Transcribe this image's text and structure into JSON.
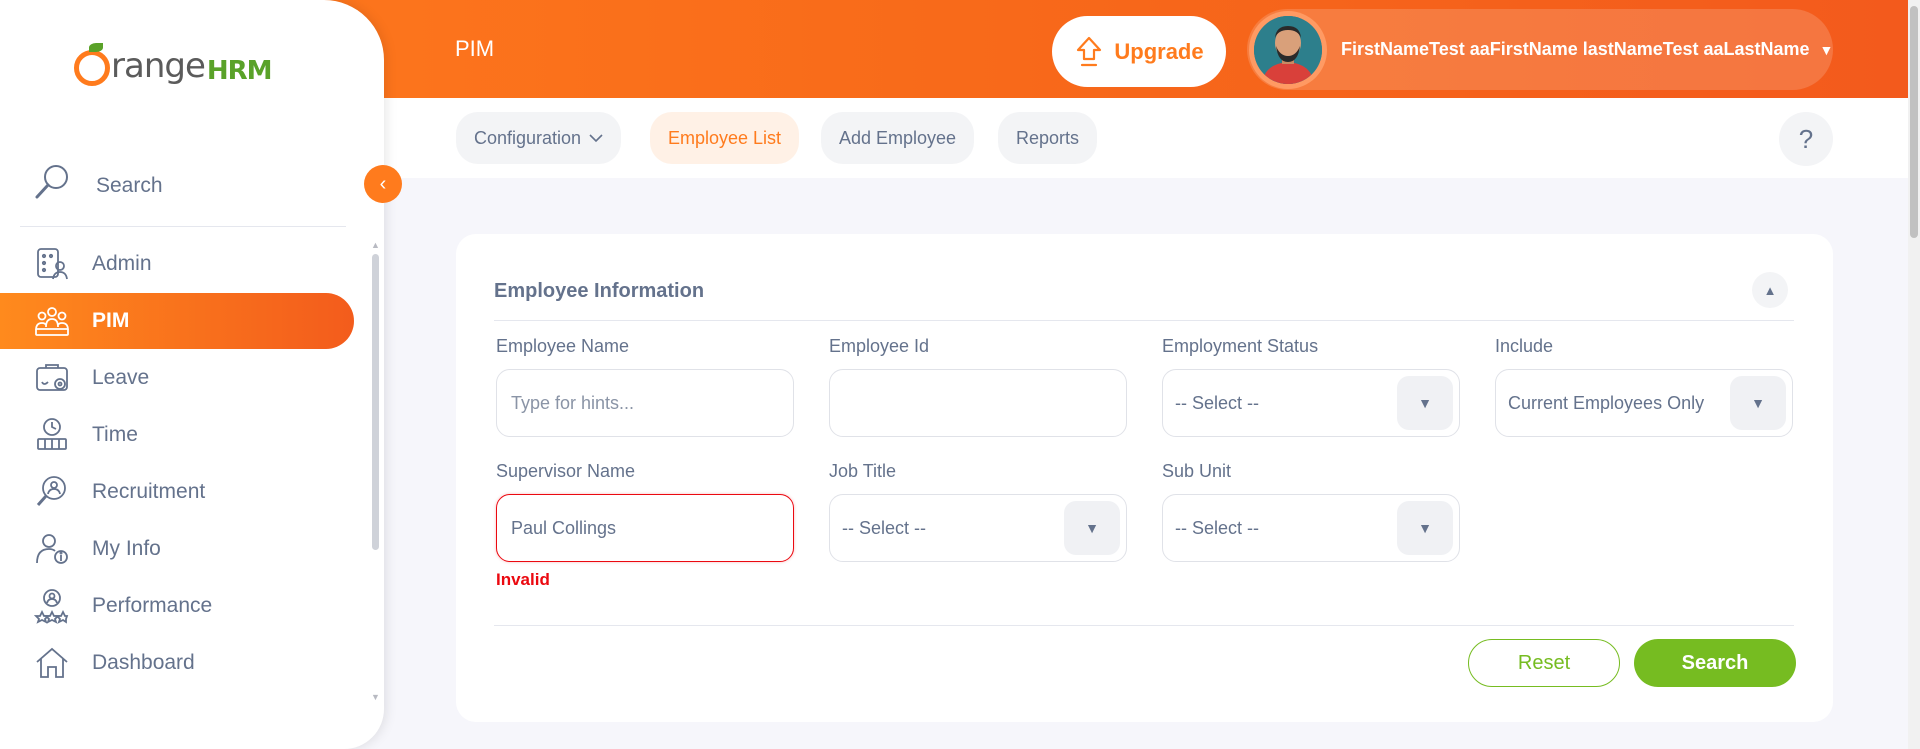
{
  "header": {
    "module_title": "PIM",
    "upgrade_label": "Upgrade",
    "user_name": "FirstNameTest aaFirstName lastNameTest aaLastName"
  },
  "sidebar": {
    "logo_word": "range",
    "logo_suffix": "HRM",
    "search_label": "Search",
    "items": [
      {
        "label": "Admin",
        "icon": "admin-icon",
        "active": false
      },
      {
        "label": "PIM",
        "icon": "pim-icon",
        "active": true
      },
      {
        "label": "Leave",
        "icon": "leave-icon",
        "active": false
      },
      {
        "label": "Time",
        "icon": "time-icon",
        "active": false
      },
      {
        "label": "Recruitment",
        "icon": "recruitment-icon",
        "active": false
      },
      {
        "label": "My Info",
        "icon": "my-info-icon",
        "active": false
      },
      {
        "label": "Performance",
        "icon": "performance-icon",
        "active": false
      },
      {
        "label": "Dashboard",
        "icon": "dashboard-icon",
        "active": false
      }
    ]
  },
  "subnav": {
    "tabs": [
      {
        "label": "Configuration",
        "has_dropdown": true,
        "active": false
      },
      {
        "label": "Employee List",
        "active": true
      },
      {
        "label": "Add Employee",
        "active": false
      },
      {
        "label": "Reports",
        "active": false
      }
    ],
    "help_label": "?"
  },
  "filter": {
    "title": "Employee Information",
    "employee_name": {
      "label": "Employee Name",
      "placeholder": "Type for hints...",
      "value": ""
    },
    "employee_id": {
      "label": "Employee Id",
      "value": ""
    },
    "employment_status": {
      "label": "Employment Status",
      "value": "-- Select --"
    },
    "include": {
      "label": "Include",
      "value": "Current Employees Only"
    },
    "supervisor_name": {
      "label": "Supervisor Name",
      "value": "Paul Collings",
      "error": "Invalid"
    },
    "job_title": {
      "label": "Job Title",
      "value": "-- Select --"
    },
    "sub_unit": {
      "label": "Sub Unit",
      "value": "-- Select --"
    },
    "reset_label": "Reset",
    "search_label": "Search"
  },
  "colors": {
    "brand_orange": "#ff7b1d",
    "action_green": "#76bc21",
    "error_red": "#eb0910",
    "text_muted": "#64728c"
  }
}
